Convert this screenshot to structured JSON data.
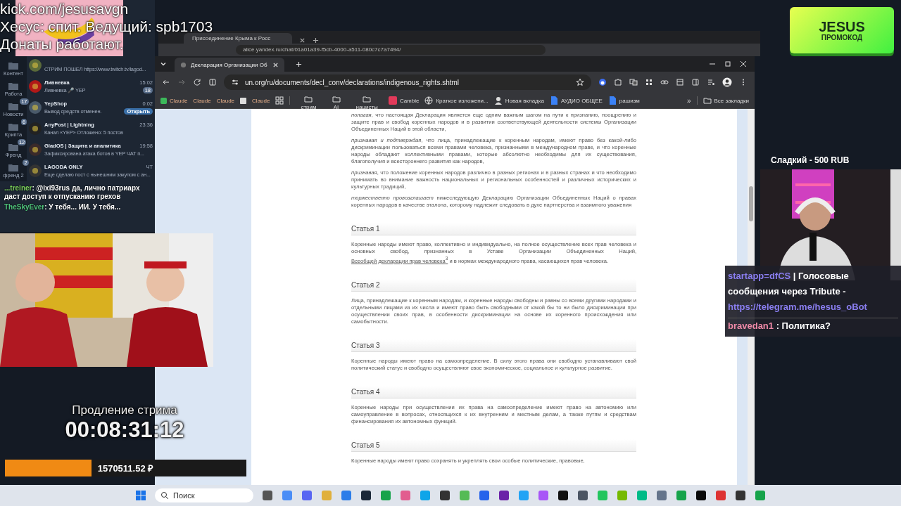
{
  "stream_overlay": {
    "lines": [
      "kick.com/jesusavgn",
      "Хесус: спит. Ведущий: spb1703",
      "Донаты работают."
    ]
  },
  "telegram": {
    "folders": [
      {
        "label": "Контент"
      },
      {
        "label": "Работа"
      },
      {
        "label": "Новости",
        "badge": "17"
      },
      {
        "label": "Крипта",
        "badge": "6"
      },
      {
        "label": "Френд",
        "badge": "12"
      },
      {
        "label": "френд 2",
        "badge": "2"
      }
    ],
    "chats": [
      {
        "preview": "СТРИМ ПОШЕЛ  https://www.twitch.tv/lagod..."
      },
      {
        "name": "Ливневка",
        "time": "15:02",
        "preview": "Ливневка 🎤 YEP",
        "badge": "18"
      },
      {
        "name": "YepShop",
        "time": "0:02",
        "preview": "Вывод средств отменен.",
        "action": "Открыть"
      },
      {
        "name": "AnyPost | Lightning",
        "time": "23:36",
        "preview": "Канал «YEP»  Отложено: 5 постов"
      },
      {
        "name": "GladOS | Защита и аналитика",
        "time": "19:58",
        "preview": "Зафиксирована атака ботов в YEP ЧАТ п..."
      },
      {
        "name": "LAGODA ONLY",
        "time": "ЧТ",
        "preview": "Еще сделаю пост с нынешним закупом с ан..."
      }
    ]
  },
  "chat_overlay": [
    {
      "user": "...treiner",
      "text": ": @ixi93rus да, лично патриарх даст доступ к отпусканию грехов",
      "color": "#7bd05a"
    },
    {
      "user": "TheSkyEver",
      "text": ": У тебя... ИИ. У тебя...",
      "color": "#4fc37a"
    }
  ],
  "timer": {
    "label": "Продление стрима",
    "time": "00:08:31:12",
    "level": 0.36,
    "amount": "1570511.52 ₽"
  },
  "back_browser": {
    "tab": "Присоединение Крыма к Росс",
    "url": "alice.yandex.ru/chat/01a01a39-f5cb-4000-a511-080c7c7a7494/"
  },
  "browser": {
    "tab": "Декларация Организации Об",
    "url": "un.org/ru/documents/decl_conv/declarations/indigenous_rights.shtml",
    "bookmarks": [
      {
        "label": "Claude",
        "kind": "claude"
      },
      {
        "label": "Claude",
        "kind": "plain"
      },
      {
        "label": "Claude",
        "kind": "plain"
      },
      {
        "kind": "page"
      },
      {
        "label": "Claude",
        "kind": "plain"
      },
      {
        "kind": "apps"
      },
      {
        "label": "стрим",
        "kind": "folder"
      },
      {
        "label": "AI",
        "kind": "folder"
      },
      {
        "label": "нацисты",
        "kind": "folder"
      },
      {
        "label": "Cambie",
        "kind": "cambie"
      },
      {
        "label": "Краткое изложени...",
        "kind": "globe"
      },
      {
        "label": "Новая вкладка",
        "kind": "newtab"
      },
      {
        "label": "АУДИО ОБЩЕЕ",
        "kind": "doc"
      },
      {
        "label": "рашизм",
        "kind": "doc"
      }
    ],
    "more": "»",
    "all_bookmarks": "Все закладки"
  },
  "document": {
    "preamble": [
      "*полагая*, что настоящая Декларация является еще одним важным шагом на пути к признанию, поощрению и защите прав и свобод коренных народов и в развитии соответствующей деятельности системы Организации Объединенных Наций в этой области,",
      "*признавая и подтверждая*, что лица, принадлежащие к коренным народам, имеют право без какой-либо дискриминации пользоваться всеми правами человека, признанными в международном праве, и что коренные народы обладают коллективными правами, которые абсолютно необходимы для их существования, благополучия и всестороннего развития как народов,",
      "*признавая*, что положение коренных народов различно в разных регионах и в разных странах и что необходимо принимать во внимание важность национальных и региональных особенностей и различных исторических и культурных традиций,",
      "*торжественно провозглашает* нижеследующую Декларацию Организации Объединенных Наций о правах коренных народов в качестве эталона, которому надлежит следовать в духе партнерства и взаимного уважения"
    ],
    "articles": [
      {
        "title": "Статья 1",
        "segments": [
          {
            "text": "Коренные народы имеют право, коллективно и индивидуально, на полное осуществление всех прав человека и основных свобод, признанных в Уставе Организации Объединенных Наций, ",
            "link": false
          },
          {
            "text": "Всеобщей декларации прав человека$^{3}$",
            "link": true
          },
          {
            "text": " и в нормах международного права, касающихся прав человека.",
            "link": false
          }
        ]
      },
      {
        "title": "Статья 2",
        "segments": [
          {
            "text": "Лица, принадлежащие к коренным народам, и коренные народы свободны и равны со всеми другими народами и отдельными лицами из их числа и имеют право быть свободными от какой бы то ни было дискриминации при осуществлении своих прав, в особенности дискриминации на основе их коренного происхождения или самобытности.",
            "link": false
          }
        ]
      },
      {
        "title": "Статья 3",
        "segments": [
          {
            "text": "Коренные народы имеют право на самоопределение. В силу этого права они свободно устанавливают свой политический статус и свободно осуществляют свое экономическое, социальное и культурное развитие.",
            "link": false
          }
        ]
      },
      {
        "title": "Статья 4",
        "segments": [
          {
            "text": "Коренные народы при осуществлении их права на самоопределение имеют право на автономию или самоуправление в вопросах, относящихся к их внутренним и местным делам, а также путям и средствам финансирования их автономных функций.",
            "link": false
          }
        ]
      },
      {
        "title": "Статья 5",
        "segments": [
          {
            "text": "Коренные народы имеют право сохранять и укреплять свои особые политические, правовые,",
            "link": false
          }
        ]
      }
    ]
  },
  "promo": {
    "brand": "JESUS",
    "label": "ПРОМОКОД"
  },
  "donation": {
    "label": "Сладкий - 500 RUB"
  },
  "right_chat": [
    {
      "parts": [
        {
          "text": "startapp=dfCS",
          "link": true
        },
        {
          "text": " | Голосовые сообщения через Tribute - ",
          "link": false
        },
        {
          "text": "https://telegram.me/hesus_oBot",
          "link": true
        }
      ]
    },
    {
      "user": "bravedan1",
      "text": " : Политика?"
    }
  ],
  "taskbar": {
    "placeholder": "Поиск"
  }
}
